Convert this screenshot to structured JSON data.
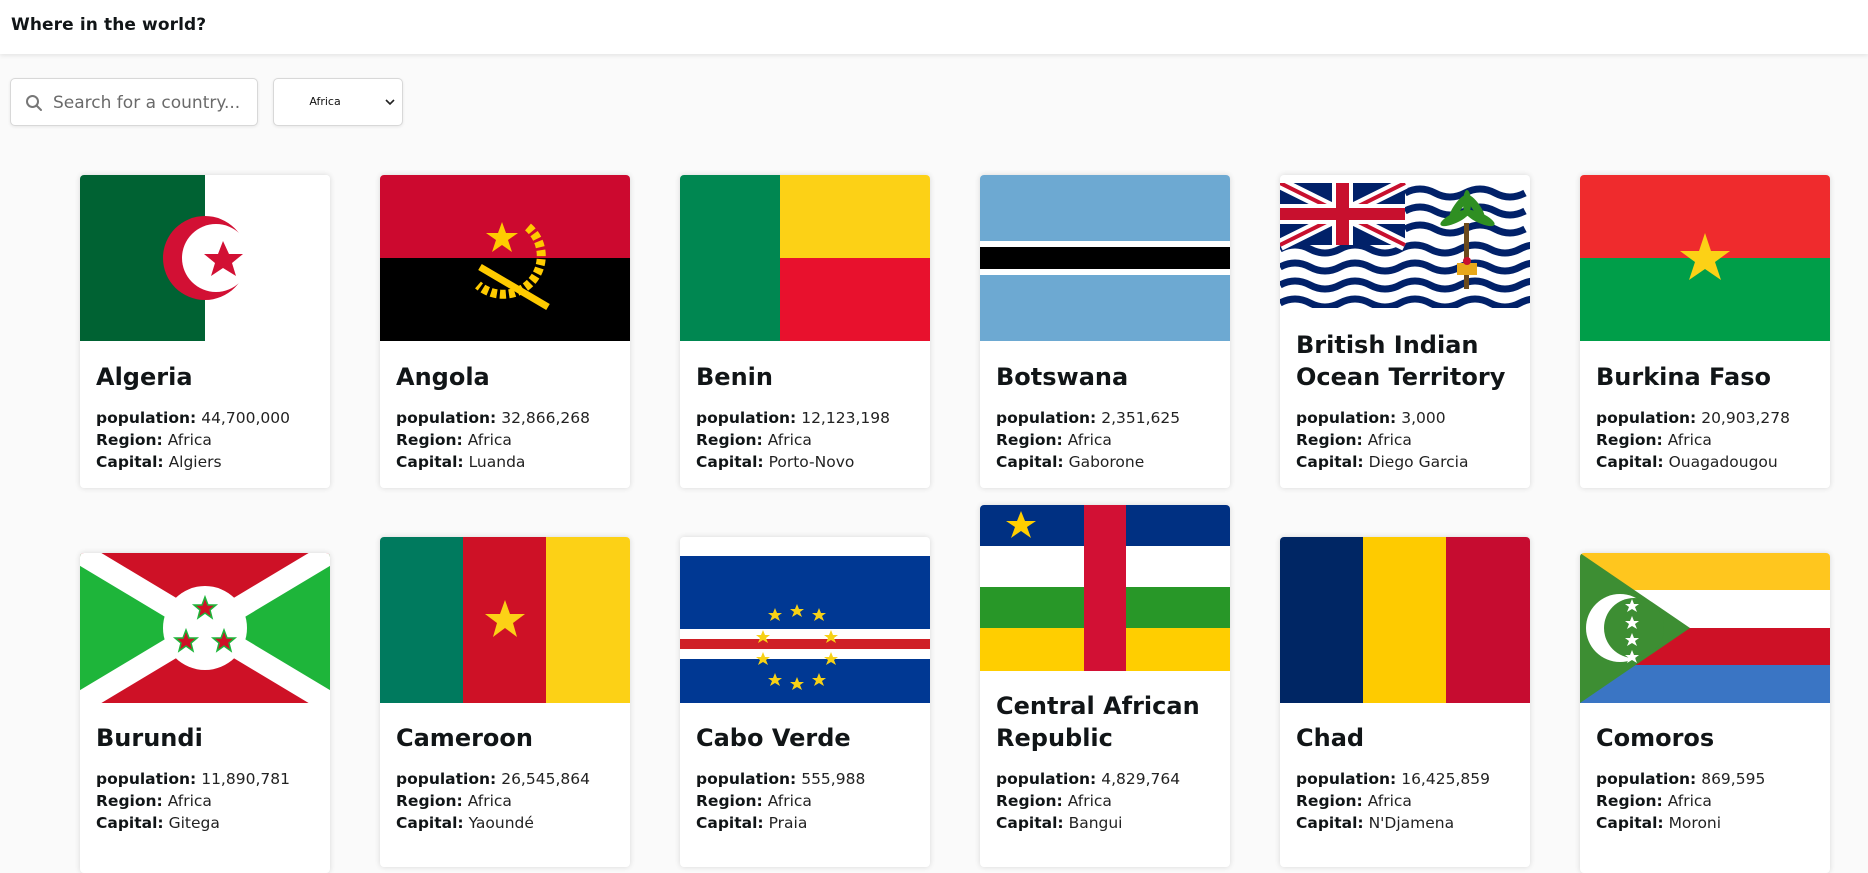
{
  "header": {
    "title": "Where in the world?"
  },
  "search": {
    "placeholder": "Search for a country..."
  },
  "filter": {
    "selected": "Africa"
  },
  "labels": {
    "population": "population:",
    "region": "Region:",
    "capital": "Capital:"
  },
  "countries": [
    {
      "name": "Algeria",
      "population": "44,700,000",
      "region": "Africa",
      "capital": "Algiers"
    },
    {
      "name": "Angola",
      "population": "32,866,268",
      "region": "Africa",
      "capital": "Luanda"
    },
    {
      "name": "Benin",
      "population": "12,123,198",
      "region": "Africa",
      "capital": "Porto-Novo"
    },
    {
      "name": "Botswana",
      "population": "2,351,625",
      "region": "Africa",
      "capital": "Gaborone"
    },
    {
      "name": "British Indian Ocean Territory",
      "population": "3,000",
      "region": "Africa",
      "capital": "Diego Garcia"
    },
    {
      "name": "Burkina Faso",
      "population": "20,903,278",
      "region": "Africa",
      "capital": "Ouagadougou"
    },
    {
      "name": "Burundi",
      "population": "11,890,781",
      "region": "Africa",
      "capital": "Gitega"
    },
    {
      "name": "Cameroon",
      "population": "26,545,864",
      "region": "Africa",
      "capital": "Yaoundé"
    },
    {
      "name": "Cabo Verde",
      "population": "555,988",
      "region": "Africa",
      "capital": "Praia"
    },
    {
      "name": "Central African Republic",
      "population": "4,829,764",
      "region": "Africa",
      "capital": "Bangui"
    },
    {
      "name": "Chad",
      "population": "16,425,859",
      "region": "Africa",
      "capital": "N'Djamena"
    },
    {
      "name": "Comoros",
      "population": "869,595",
      "region": "Africa",
      "capital": "Moroni"
    }
  ]
}
